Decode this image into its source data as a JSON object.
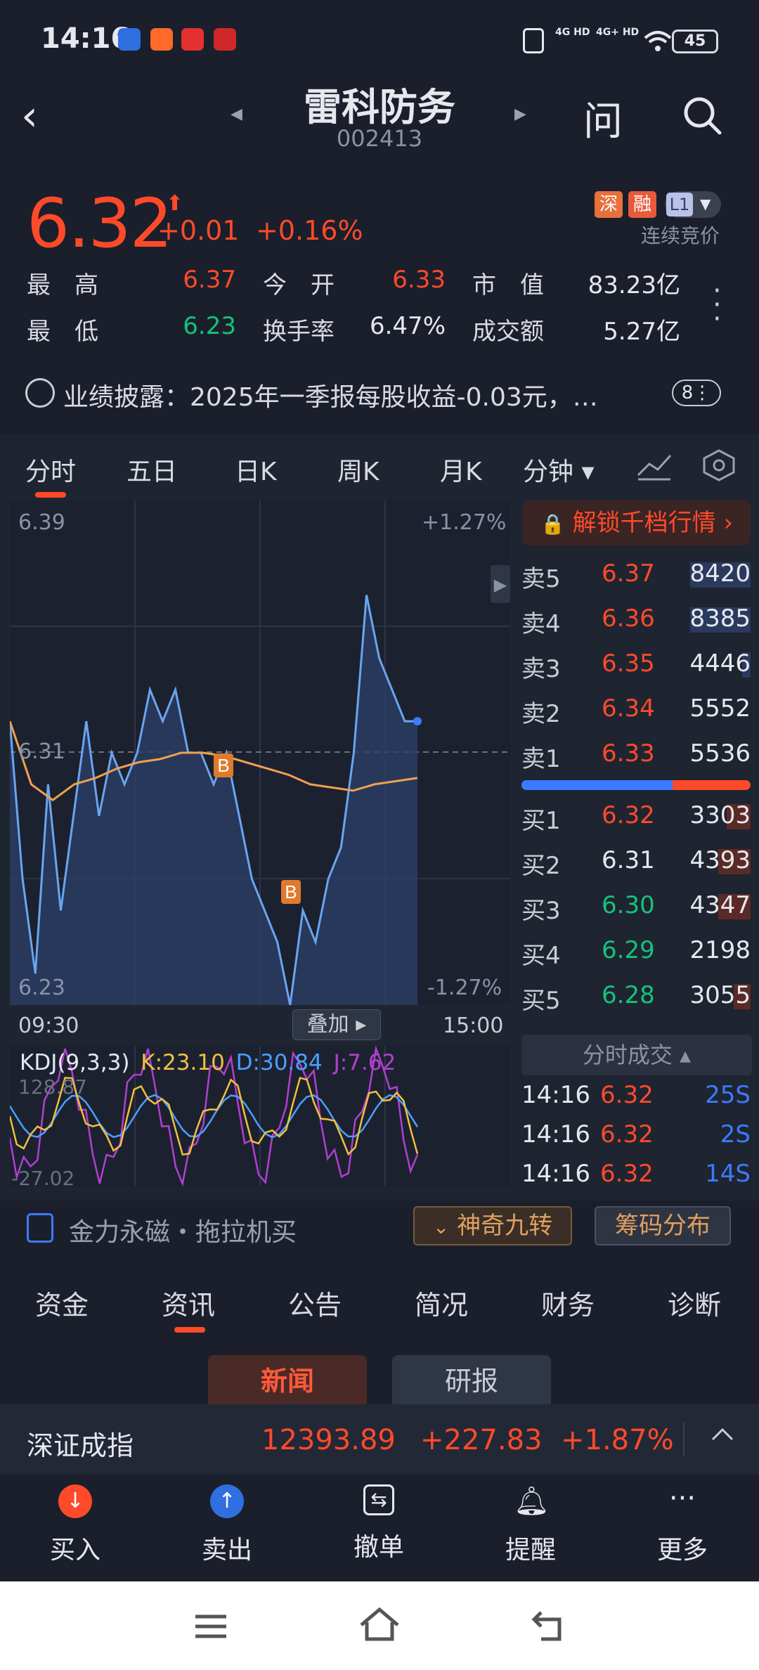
{
  "status": {
    "time": "14:16",
    "network1": "4G HD",
    "network2": "4G+ HD",
    "battery": "45"
  },
  "header": {
    "name": "雷科防务",
    "code": "002413",
    "ask_label": "问"
  },
  "quote": {
    "price": "6.32",
    "change": "+0.01",
    "change_pct": "+0.16%",
    "tags": [
      "深",
      "融",
      "L1"
    ],
    "auction": "连续竞价",
    "stats": [
      {
        "label": "最　高",
        "value": "6.37",
        "color": "red"
      },
      {
        "label": "今　开",
        "value": "6.33",
        "color": "red"
      },
      {
        "label": "市　值",
        "value": "83.23亿",
        "color": "white"
      },
      {
        "label": "最　低",
        "value": "6.23",
        "color": "green"
      },
      {
        "label": "换手率",
        "value": "6.47%",
        "color": "white"
      },
      {
        "label": "成交额",
        "value": "5.27亿",
        "color": "white"
      }
    ]
  },
  "notice": {
    "text": "业绩披露：2025年一季报每股收益-0.03元，…",
    "badge": "8⋮"
  },
  "chart_tabs": [
    "分时",
    "五日",
    "日K",
    "周K",
    "月K",
    "分钟 ▾"
  ],
  "chart_labels": {
    "top_price": "6.39",
    "top_pct": "+1.27%",
    "mid_price": "6.31",
    "bottom_price": "6.23",
    "bottom_pct": "-1.27%",
    "start_time": "09:30",
    "end_time": "15:00",
    "overlay": "叠加 ▸",
    "marker": "B"
  },
  "kdj": {
    "title": "KDJ(9,3,3)",
    "k": "K:23.10",
    "d": "D:30.84",
    "j": "J:7.62",
    "max": "128.87",
    "min": "-27.02"
  },
  "chart_data": {
    "type": "line",
    "xlabel": "",
    "ylabel": "",
    "ylim": [
      6.23,
      6.39
    ],
    "x_range": [
      "09:30",
      "15:00"
    ],
    "series": [
      {
        "values": [
          6.32,
          6.27,
          6.24,
          6.3,
          6.26,
          6.29,
          6.32,
          6.29,
          6.31,
          6.3,
          6.31,
          6.33,
          6.32,
          6.33,
          6.31,
          6.31,
          6.3,
          6.31,
          6.29,
          6.27,
          6.26,
          6.25,
          6.23,
          6.26,
          6.25,
          6.27,
          6.28,
          6.31,
          6.36,
          6.34,
          6.33,
          6.32,
          6.32
        ],
        "color": "#6aa5ef"
      },
      {
        "values": [
          6.32,
          6.3,
          6.295,
          6.3,
          6.302,
          6.305,
          6.307,
          6.308,
          6.31,
          6.31,
          6.309,
          6.307,
          6.305,
          6.303,
          6.3,
          6.299,
          6.298,
          6.3,
          6.301,
          6.302
        ],
        "color": "#f0a050"
      }
    ]
  },
  "orderbook": {
    "unlock": "解锁千档行情 ›",
    "asks": [
      {
        "label": "卖5",
        "price": "6.37",
        "vol": "8420",
        "color": "red",
        "bar": 0.72
      },
      {
        "label": "卖4",
        "price": "6.36",
        "vol": "8385",
        "color": "red",
        "bar": 0.72
      },
      {
        "label": "卖3",
        "price": "6.35",
        "vol": "4446",
        "color": "red",
        "bar": 0.1
      },
      {
        "label": "卖2",
        "price": "6.34",
        "vol": "5552",
        "color": "red",
        "bar": 0.0
      },
      {
        "label": "卖1",
        "price": "6.33",
        "vol": "5536",
        "color": "red",
        "bar": 0.0
      }
    ],
    "bids": [
      {
        "label": "买1",
        "price": "6.32",
        "vol": "3303",
        "color": "red",
        "bar": 0.28
      },
      {
        "label": "买2",
        "price": "6.31",
        "vol": "4393",
        "color": "white",
        "bar": 0.38
      },
      {
        "label": "买3",
        "price": "6.30",
        "vol": "4347",
        "color": "green",
        "bar": 0.38
      },
      {
        "label": "买4",
        "price": "6.29",
        "vol": "2198",
        "color": "green",
        "bar": 0.0
      },
      {
        "label": "买5",
        "price": "6.28",
        "vol": "3055",
        "color": "green",
        "bar": 0.2
      }
    ],
    "split_buy_fraction": 0.66
  },
  "ticks": {
    "header": "分时成交 ▴",
    "rows": [
      {
        "time": "14:16",
        "price": "6.32",
        "vol": "25S"
      },
      {
        "time": "14:16",
        "price": "6.32",
        "vol": "2S"
      },
      {
        "time": "14:16",
        "price": "6.32",
        "vol": "14S"
      }
    ]
  },
  "strategy": {
    "text": "金力永磁・拖拉机买",
    "btn_nine": "神奇九转",
    "btn_chip": "筹码分布"
  },
  "info_tabs": [
    "资金",
    "资讯",
    "公告",
    "简况",
    "财务",
    "诊断"
  ],
  "sub_tabs": {
    "news": "新闻",
    "report": "研报"
  },
  "index": {
    "name": "深证成指",
    "value": "12393.89",
    "change": "+227.83",
    "pct": "+1.87%"
  },
  "trade": [
    {
      "label": "买入",
      "icon": "buy-icon"
    },
    {
      "label": "卖出",
      "icon": "sell-icon"
    },
    {
      "label": "撤单",
      "icon": "cancel-order-icon"
    },
    {
      "label": "提醒",
      "icon": "bell-icon"
    },
    {
      "label": "更多",
      "icon": "more-icon"
    }
  ],
  "colors": {
    "up": "#ff4a2a",
    "down": "#14c27a",
    "accent_blue": "#3b7bff",
    "price_line": "#6aa5ef",
    "avg_line": "#f0a050"
  }
}
